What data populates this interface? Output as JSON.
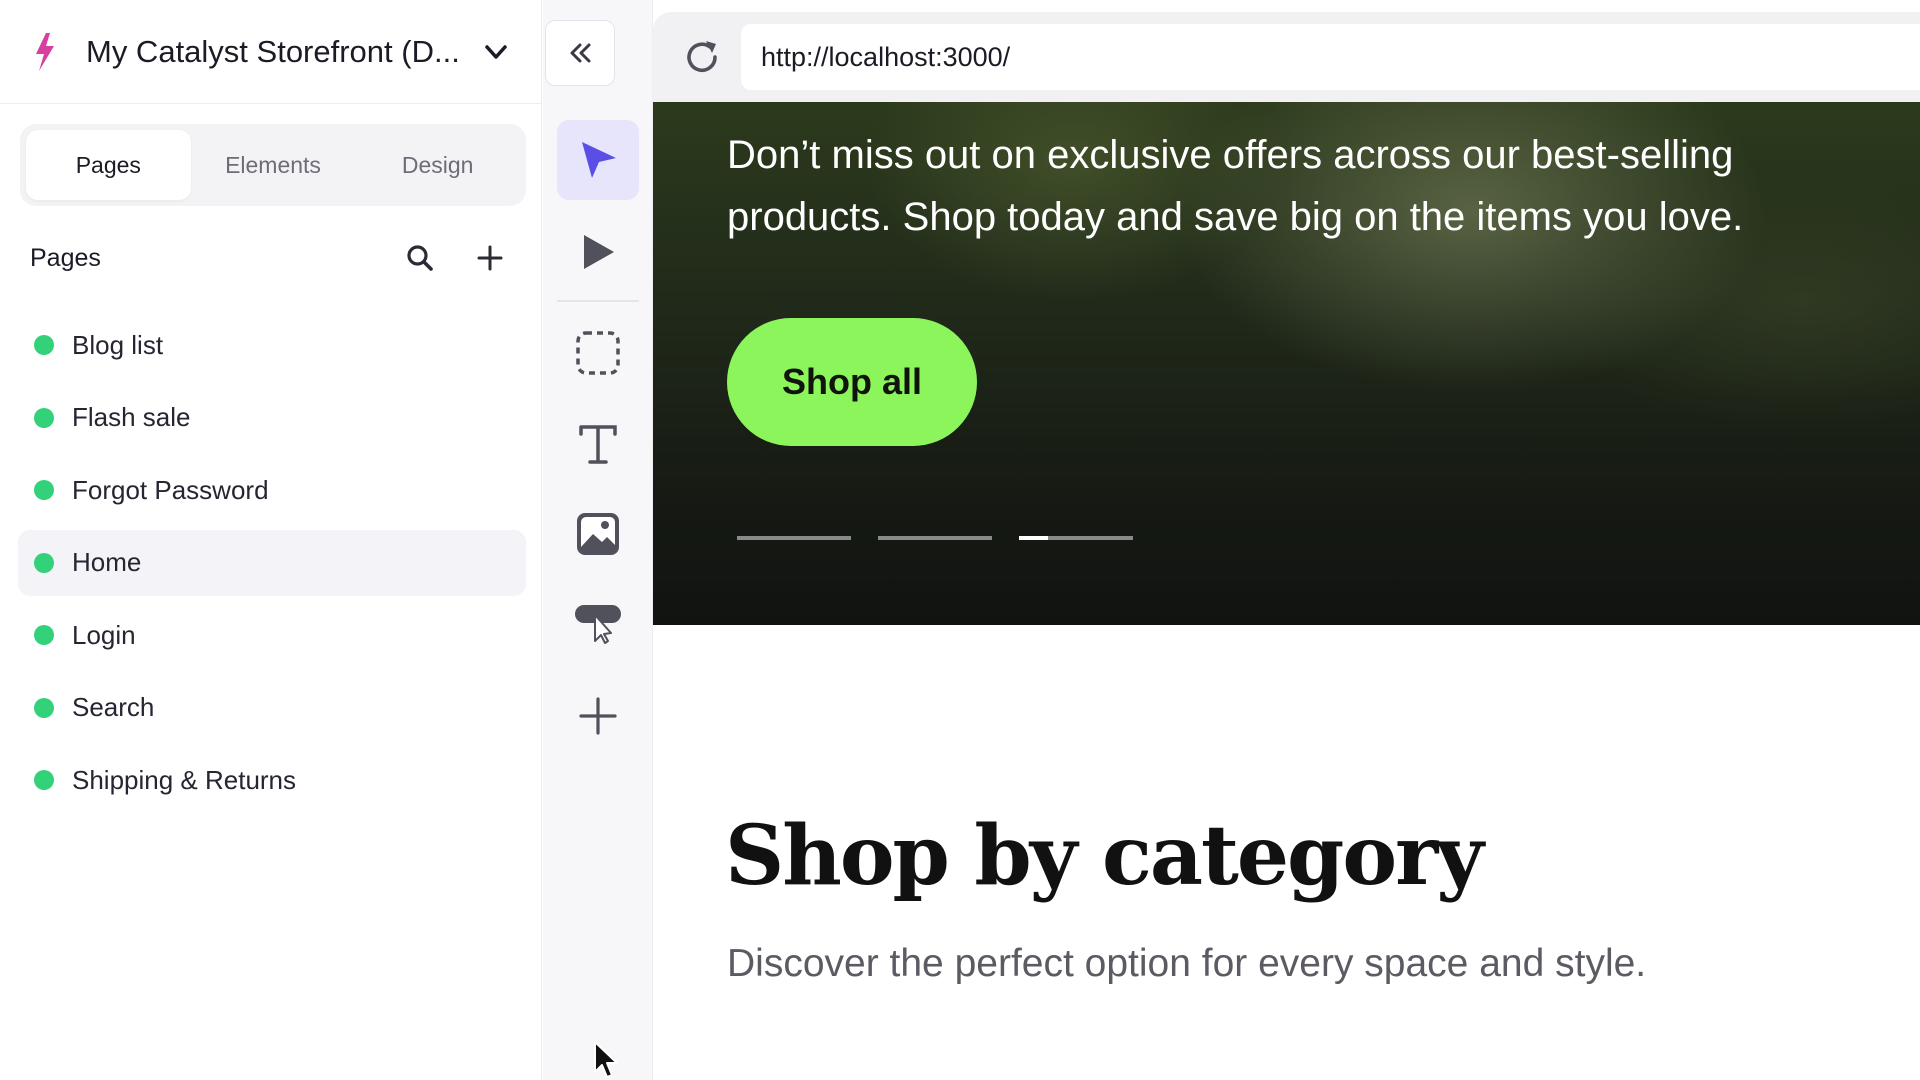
{
  "project": {
    "name": "My Catalyst Storefront (D...",
    "logo_icon": "lightning-bolt-icon",
    "brand_color": "#d6409f"
  },
  "tabs": [
    {
      "label": "Pages",
      "active": true
    },
    {
      "label": "Elements",
      "active": false
    },
    {
      "label": "Design",
      "active": false
    }
  ],
  "pages_panel": {
    "title": "Pages",
    "search_icon": "search-icon",
    "add_icon": "plus-icon",
    "items": [
      {
        "label": "Blog list",
        "status_color": "#34d17b"
      },
      {
        "label": "Flash sale",
        "status_color": "#34d17b"
      },
      {
        "label": "Forgot Password",
        "status_color": "#34d17b"
      },
      {
        "label": "Home",
        "status_color": "#34d17b",
        "selected": true
      },
      {
        "label": "Login",
        "status_color": "#34d17b"
      },
      {
        "label": "Search",
        "status_color": "#34d17b"
      },
      {
        "label": "Shipping & Returns",
        "status_color": "#34d17b"
      }
    ]
  },
  "toolbar": {
    "collapse_icon": "double-chevron-left-icon",
    "tools": [
      {
        "name": "select-tool",
        "icon": "cursor-arrow-icon",
        "active": true
      },
      {
        "name": "preview-tool",
        "icon": "play-icon",
        "active": false
      },
      {
        "name": "box-tool",
        "icon": "dashed-square-icon",
        "active": false
      },
      {
        "name": "text-tool",
        "icon": "text-icon",
        "active": false
      },
      {
        "name": "image-tool",
        "icon": "image-icon",
        "active": false
      },
      {
        "name": "button-tool",
        "icon": "button-click-icon",
        "active": false
      },
      {
        "name": "add-tool",
        "icon": "plus-icon",
        "active": false
      }
    ],
    "accent_color": "#5b4ee6"
  },
  "browser": {
    "url": "http://localhost:3000/",
    "reload_icon": "reload-icon"
  },
  "hero": {
    "text": "Don’t miss out on exclusive offers across our best-selling products. Shop today and save big on the items you love.",
    "button_label": "Shop all",
    "button_color": "#8cf55c",
    "slides": [
      {
        "progress": 0
      },
      {
        "progress": 0
      },
      {
        "progress": 0.25
      }
    ]
  },
  "section": {
    "title": "Shop by category",
    "subtitle": "Discover the perfect option for every space and style."
  }
}
